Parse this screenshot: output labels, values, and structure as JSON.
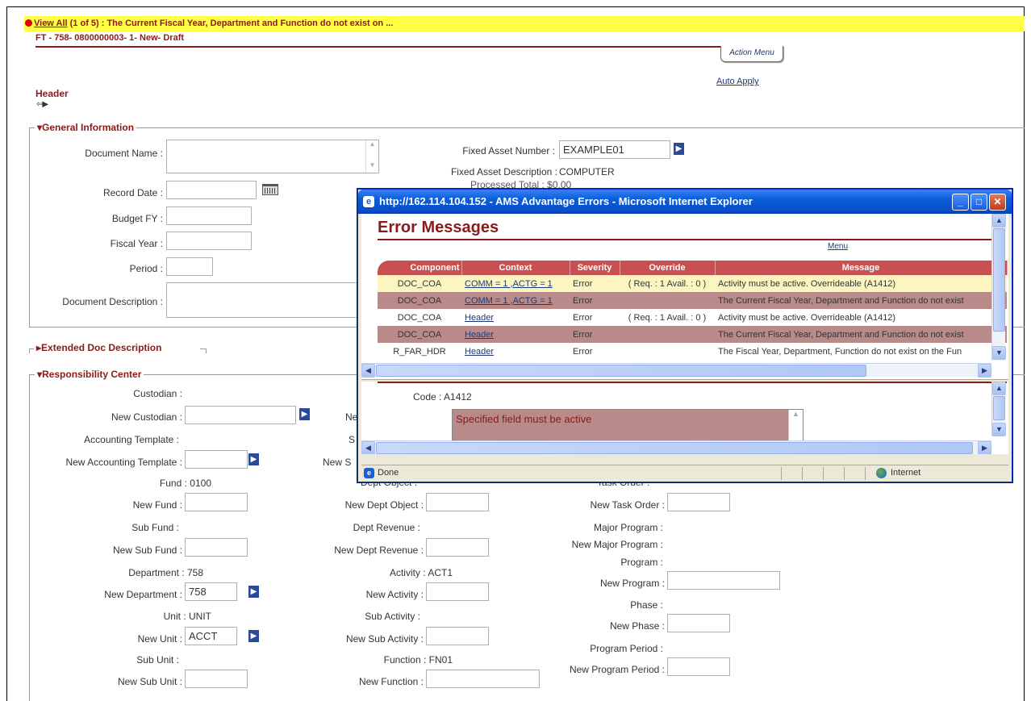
{
  "error_bar": {
    "link": "View All",
    "text": " (1 of 5) : The Current Fiscal Year, Department and Function do not exist on ..."
  },
  "document": {
    "id": "FT - 758- 0800000003- 1- New- Draft",
    "action_menu": "Action Menu",
    "auto_apply": "Auto Apply",
    "header_label": "Header",
    "nav_arrows": "⇦▶"
  },
  "general": {
    "title": "General Information",
    "document_name": "Document Name :",
    "record_date": "Record Date :",
    "budget_fy": "Budget FY :",
    "fiscal_year": "Fiscal Year :",
    "period": "Period :",
    "document_description": "Document Description :",
    "fixed_asset_number_label": "Fixed Asset Number :",
    "fixed_asset_number_value": "EXAMPLE01",
    "fixed_asset_description_label": "Fixed Asset Description :",
    "fixed_asset_description_value": "COMPUTER",
    "hidden_total": "Processed Total : $0.00"
  },
  "extended": {
    "title": "Extended Doc Description"
  },
  "resp": {
    "title": "Responsibility Center",
    "custodian": "Custodian :",
    "new_custodian": "New Custodian :",
    "accounting_template": "Accounting Template :",
    "new_accounting_template": "New Accounting Template :",
    "fund": "Fund :",
    "fund_value": "0100",
    "new_fund": "New Fund :",
    "sub_fund": "Sub Fund :",
    "new_sub_fund": "New Sub Fund :",
    "department": "Department :",
    "department_value": "758",
    "new_department": "New Department :",
    "new_department_value": "758",
    "unit": "Unit :",
    "unit_value": "UNIT",
    "new_unit": "New Unit :",
    "new_unit_value": "ACCT",
    "sub_unit": "Sub Unit :",
    "new_sub_unit": "New Sub Unit :",
    "col2_ne": "Ne",
    "col2_s": "S",
    "col2_news": "New S",
    "dept_object_partial": "Dept Object :",
    "new_dept_object": "New Dept Object :",
    "dept_revenue": "Dept Revenue :",
    "new_dept_revenue": "New Dept Revenue :",
    "activity": "Activity :",
    "activity_value": "ACT1",
    "new_activity": "New Activity :",
    "sub_activity": "Sub Activity :",
    "new_sub_activity": "New Sub Activity :",
    "function": "Function :",
    "function_value": "FN01",
    "new_function": "New Function :",
    "task_order_partial": "Task Order :",
    "new_task_order": "New Task Order :",
    "major_program": "Major Program :",
    "new_major_program": "New Major Program :",
    "program": "Program :",
    "new_program": "New Program :",
    "phase": "Phase :",
    "new_phase": "New Phase :",
    "program_period": "Program Period :",
    "new_program_period": "New Program Period :"
  },
  "popup": {
    "title": "http://162.114.104.152 - AMS Advantage Errors - Microsoft Internet Explorer",
    "heading": "Error Messages",
    "menu": "Menu",
    "columns": [
      "Component",
      "Context",
      "Severity",
      "Override",
      "Message"
    ],
    "rows": [
      {
        "component": "DOC_COA",
        "context": "COMM = 1 ,ACTG = 1",
        "severity": "Error",
        "override": "( Req. : 1 Avail. : 0 )",
        "message": "Activity must be active. Overrideable (A1412)"
      },
      {
        "component": "DOC_COA",
        "context": "COMM = 1 ,ACTG = 1",
        "severity": "Error",
        "override": "",
        "message": "The Current Fiscal Year, Department and Function do not exist"
      },
      {
        "component": "DOC_COA",
        "context": "Header",
        "severity": "Error",
        "override": "( Req. : 1 Avail. : 0 )",
        "message": "Activity must be active. Overrideable (A1412)"
      },
      {
        "component": "DOC_COA",
        "context": "Header",
        "severity": "Error",
        "override": "",
        "message": "The Current Fiscal Year, Department and Function do not exist"
      },
      {
        "component": "R_FAR_HDR",
        "context": "Header",
        "severity": "Error",
        "override": "",
        "message": "The Fiscal Year, Department, Function do not exist on the Fun"
      }
    ],
    "code_label": "Code : A1412",
    "code_message": "Specified field must be active",
    "status_done": "Done",
    "status_zone": "Internet",
    "win_min": "_",
    "win_max": "□",
    "win_close": "✕"
  }
}
